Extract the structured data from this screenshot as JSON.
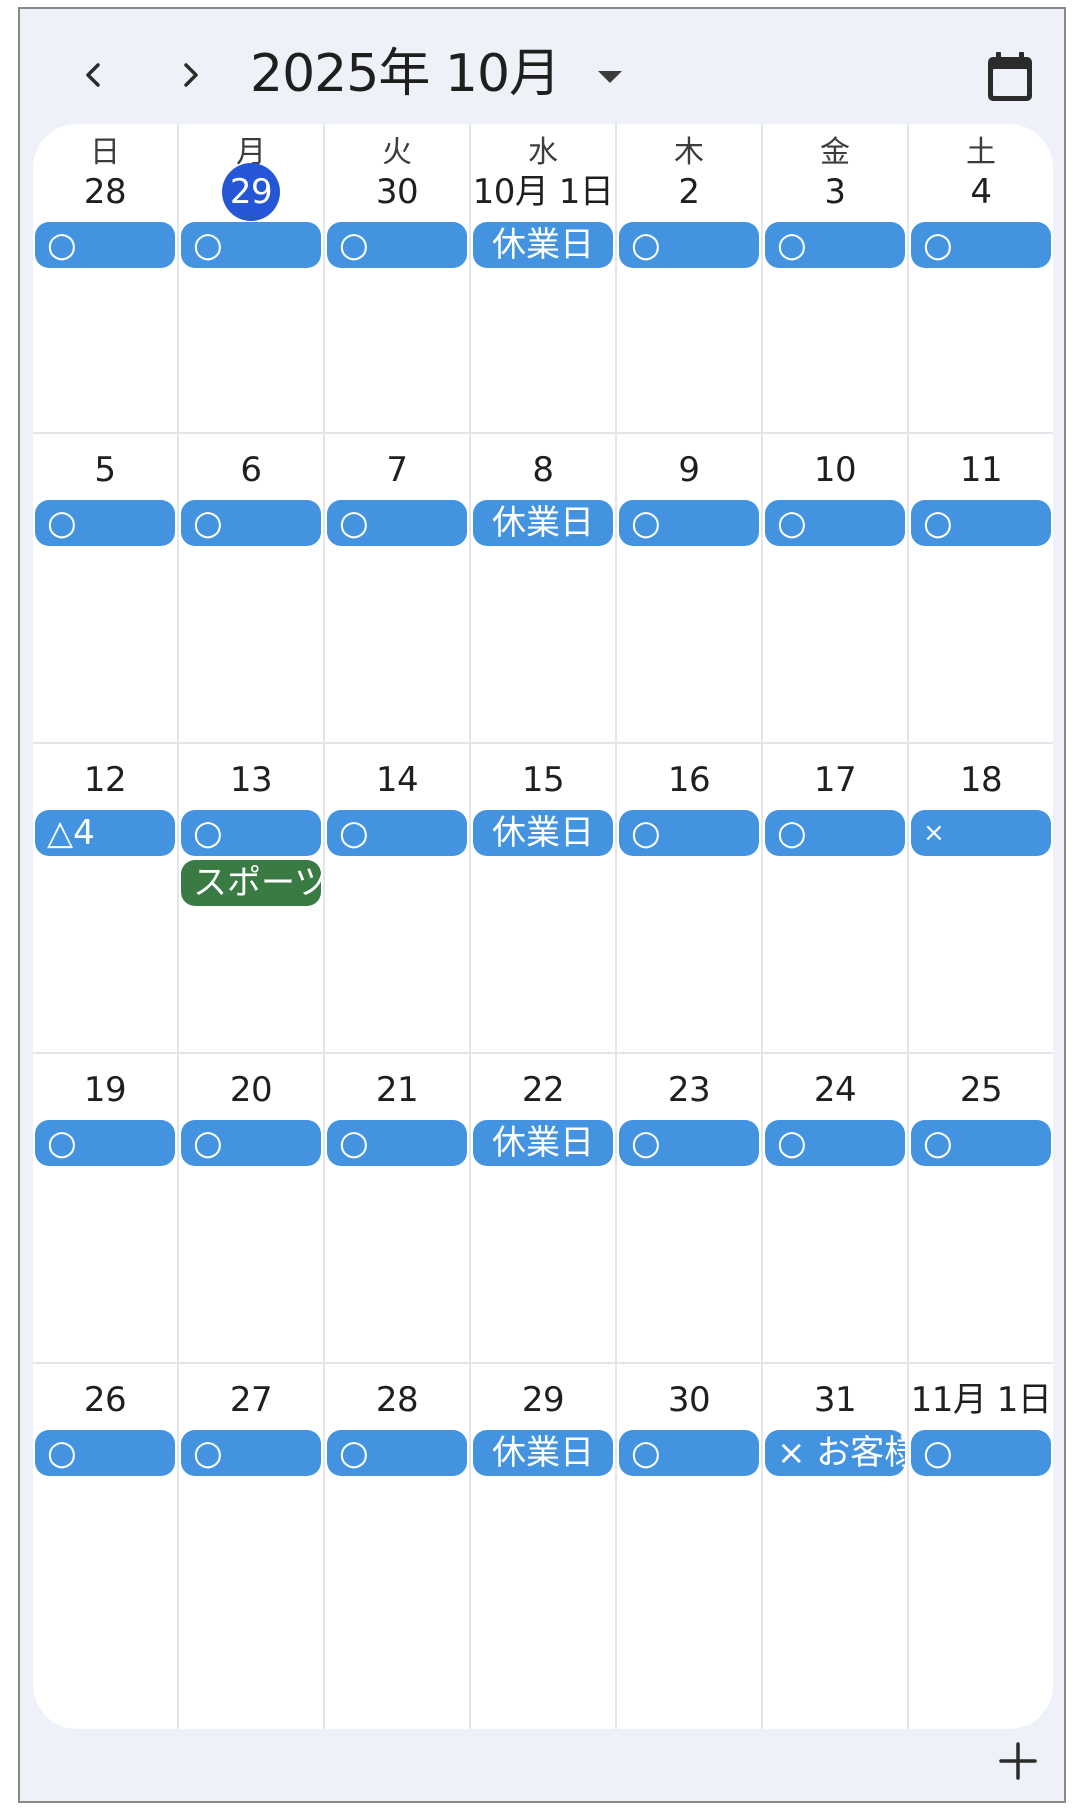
{
  "header": {
    "month_title": "2025年 10月"
  },
  "weekdays": [
    "日",
    "月",
    "火",
    "水",
    "木",
    "金",
    "土"
  ],
  "weeks": [
    {
      "days": [
        {
          "date": "28",
          "events": [
            {
              "label": "○"
            }
          ]
        },
        {
          "date": "29",
          "today": true,
          "events": [
            {
              "label": "○"
            }
          ]
        },
        {
          "date": "30",
          "events": [
            {
              "label": "○"
            }
          ]
        },
        {
          "date": "10月 1日",
          "events": [
            {
              "label": "休業日"
            }
          ]
        },
        {
          "date": "2",
          "events": [
            {
              "label": "○"
            }
          ]
        },
        {
          "date": "3",
          "events": [
            {
              "label": "○"
            }
          ]
        },
        {
          "date": "4",
          "events": [
            {
              "label": "○"
            }
          ]
        }
      ]
    },
    {
      "days": [
        {
          "date": "5",
          "events": [
            {
              "label": "○"
            }
          ]
        },
        {
          "date": "6",
          "events": [
            {
              "label": "○"
            }
          ]
        },
        {
          "date": "7",
          "events": [
            {
              "label": "○"
            }
          ]
        },
        {
          "date": "8",
          "events": [
            {
              "label": "休業日"
            }
          ]
        },
        {
          "date": "9",
          "events": [
            {
              "label": "○"
            }
          ]
        },
        {
          "date": "10",
          "events": [
            {
              "label": "○"
            }
          ]
        },
        {
          "date": "11",
          "events": [
            {
              "label": "○"
            }
          ]
        }
      ]
    },
    {
      "days": [
        {
          "date": "12",
          "events": [
            {
              "label": "△4"
            }
          ]
        },
        {
          "date": "13",
          "events": [
            {
              "label": "○"
            },
            {
              "label": "スポーツ",
              "green": true
            }
          ]
        },
        {
          "date": "14",
          "events": [
            {
              "label": "○"
            }
          ]
        },
        {
          "date": "15",
          "events": [
            {
              "label": "休業日"
            }
          ]
        },
        {
          "date": "16",
          "events": [
            {
              "label": "○"
            }
          ]
        },
        {
          "date": "17",
          "events": [
            {
              "label": "○"
            }
          ]
        },
        {
          "date": "18",
          "events": [
            {
              "label": "×"
            }
          ]
        }
      ]
    },
    {
      "days": [
        {
          "date": "19",
          "events": [
            {
              "label": "○"
            }
          ]
        },
        {
          "date": "20",
          "events": [
            {
              "label": "○"
            }
          ]
        },
        {
          "date": "21",
          "events": [
            {
              "label": "○"
            }
          ]
        },
        {
          "date": "22",
          "events": [
            {
              "label": "休業日"
            }
          ]
        },
        {
          "date": "23",
          "events": [
            {
              "label": "○"
            }
          ]
        },
        {
          "date": "24",
          "events": [
            {
              "label": "○"
            }
          ]
        },
        {
          "date": "25",
          "events": [
            {
              "label": "○"
            }
          ]
        }
      ]
    },
    {
      "days": [
        {
          "date": "26",
          "events": [
            {
              "label": "○"
            }
          ]
        },
        {
          "date": "27",
          "events": [
            {
              "label": "○"
            }
          ]
        },
        {
          "date": "28",
          "events": [
            {
              "label": "○"
            }
          ]
        },
        {
          "date": "29",
          "events": [
            {
              "label": "休業日"
            }
          ]
        },
        {
          "date": "30",
          "events": [
            {
              "label": "○"
            }
          ]
        },
        {
          "date": "31",
          "events": [
            {
              "label": "× お客様"
            }
          ]
        },
        {
          "date": "11月 1日",
          "events": [
            {
              "label": "○"
            }
          ]
        }
      ]
    }
  ],
  "icons": {
    "prev": "chevron-left-icon",
    "next": "chevron-right-icon",
    "dropdown": "caret-down-icon",
    "calendar": "calendar-icon",
    "add": "plus-icon"
  },
  "colors": {
    "event_blue": "#4493e1",
    "event_green": "#3a7b44",
    "today_circle": "#2456d6",
    "background": "#eef2f8"
  }
}
